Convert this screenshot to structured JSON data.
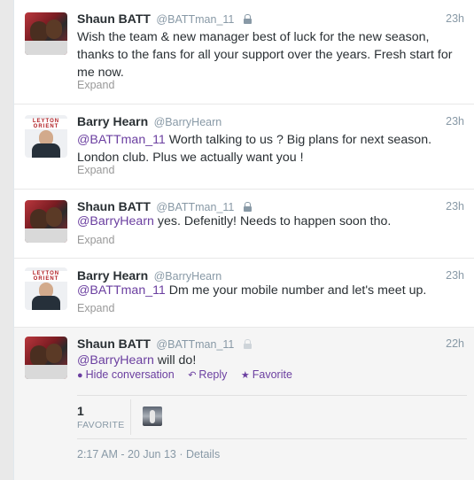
{
  "tweets": [
    {
      "name": "Shaun BATT",
      "handle": "@BATTman_11",
      "time": "23h",
      "lines": [
        "Wish the team & new manager best of luck for the new season,",
        "thanks to the fans for all your support over the years. Fresh start for",
        "me now."
      ],
      "expand": "Expand"
    },
    {
      "name": "Barry Hearn",
      "handle": "@BarryHearn",
      "time": "23h",
      "mention": "@BATTman_11",
      "line1_rest": " Worth talking to us ? Big plans for next season.",
      "line2": "London club. Plus we actually want you !",
      "expand": "Expand",
      "avatar_text": "LEYTON ORIENT"
    },
    {
      "name": "Shaun BATT",
      "handle": "@BATTman_11",
      "time": "23h",
      "mention": "@BarryHearn",
      "rest": " yes. Defenitly! Needs to happen soon tho.",
      "expand": "Expand"
    },
    {
      "name": "Barry Hearn",
      "handle": "@BarryHearn",
      "time": "23h",
      "mention": "@BATTman_11",
      "rest": " Dm me your mobile number and let's meet up.",
      "expand": "Expand",
      "avatar_text": "LEYTON ORIENT"
    },
    {
      "name": "Shaun BATT",
      "handle": "@BATTman_11",
      "time": "22h",
      "mention": "@BarryHearn",
      "rest": " will do!",
      "actions": {
        "hide_conversation": "Hide conversation",
        "reply": "Reply",
        "favorite": "Favorite"
      },
      "stats": {
        "count": "1",
        "label": "FAVORITE"
      },
      "footer": {
        "timestamp": "2:17 AM - 20 Jun 13",
        "separator": " · ",
        "details": "Details"
      }
    }
  ],
  "colors": {
    "mention": "#6b3fa0",
    "muted": "#8899a6",
    "text": "#292f33"
  },
  "icons": [
    "lock-icon",
    "speech-bubble-icon",
    "reply-arrow-icon",
    "star-icon"
  ]
}
